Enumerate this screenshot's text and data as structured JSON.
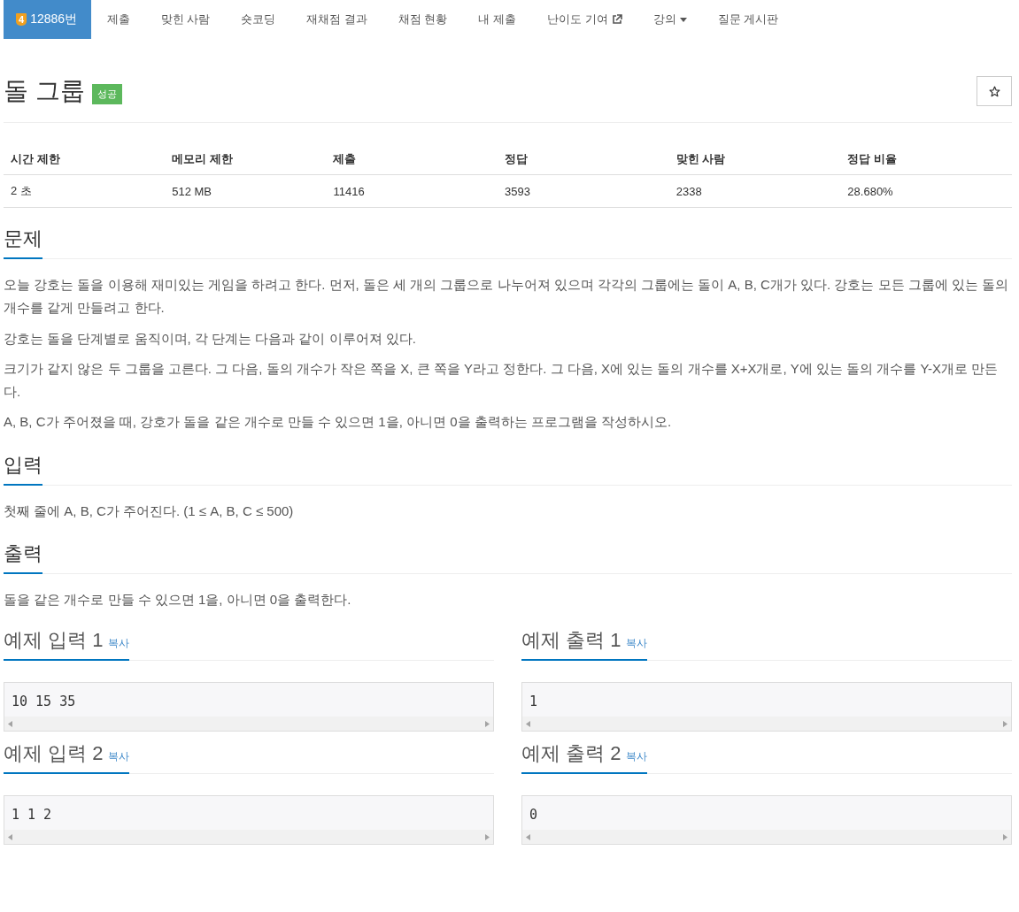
{
  "nav": [
    {
      "label": "12886번",
      "selected": true,
      "kind": "problem",
      "badge": "4"
    },
    {
      "label": "제출",
      "selected": false,
      "kind": "link"
    },
    {
      "label": "맞힌 사람",
      "selected": false,
      "kind": "link"
    },
    {
      "label": "숏코딩",
      "selected": false,
      "kind": "link"
    },
    {
      "label": "재채점 결과",
      "selected": false,
      "kind": "link"
    },
    {
      "label": "채점 현황",
      "selected": false,
      "kind": "link"
    },
    {
      "label": "내 제출",
      "selected": false,
      "kind": "link"
    },
    {
      "label": "난이도 기여",
      "selected": false,
      "kind": "external"
    },
    {
      "label": "강의",
      "selected": false,
      "kind": "dropdown"
    },
    {
      "label": "질문 게시판",
      "selected": false,
      "kind": "link"
    }
  ],
  "problem": {
    "title": "돌 그룹",
    "status": "성공",
    "starred": false
  },
  "info_table": {
    "columns": [
      "시간 제한",
      "메모리 제한",
      "제출",
      "정답",
      "맞힌 사람",
      "정답 비율"
    ],
    "row": [
      "2 초",
      "512 MB",
      "11416",
      "3593",
      "2338",
      "28.680%"
    ]
  },
  "sections": [
    {
      "heading": "문제",
      "paragraphs": [
        "오늘 강호는 돌을 이용해 재미있는 게임을 하려고 한다. 먼저, 돌은 세 개의 그룹으로 나누어져 있으며 각각의 그룹에는 돌이 A, B, C개가 있다. 강호는 모든 그룹에 있는 돌의 개수를 같게 만들려고 한다.",
        "강호는 돌을 단계별로 움직이며, 각 단계는 다음과 같이 이루어져 있다.",
        "크기가 같지 않은 두 그룹을 고른다. 그 다음, 돌의 개수가 작은 쪽을 X, 큰 쪽을 Y라고 정한다. 그 다음, X에 있는 돌의 개수를 X+X개로, Y에 있는 돌의 개수를 Y-X개로 만든다.",
        "A, B, C가 주어졌을 때, 강호가 돌을 같은 개수로 만들 수 있으면 1을, 아니면 0을 출력하는 프로그램을 작성하시오."
      ]
    },
    {
      "heading": "입력",
      "paragraphs": [
        "첫째 줄에 A, B, C가 주어진다. (1 ≤ A, B, C ≤ 500)"
      ]
    },
    {
      "heading": "출력",
      "paragraphs": [
        "돌을 같은 개수로 만들 수 있으면 1을, 아니면 0을 출력한다."
      ]
    }
  ],
  "samples": [
    {
      "title": "예제 입력 1",
      "copy": "복사",
      "content": "10 15 35"
    },
    {
      "title": "예제 출력 1",
      "copy": "복사",
      "content": "1"
    },
    {
      "title": "예제 입력 2",
      "copy": "복사",
      "content": "1 1 2"
    },
    {
      "title": "예제 출력 2",
      "copy": "복사",
      "content": "0"
    }
  ]
}
